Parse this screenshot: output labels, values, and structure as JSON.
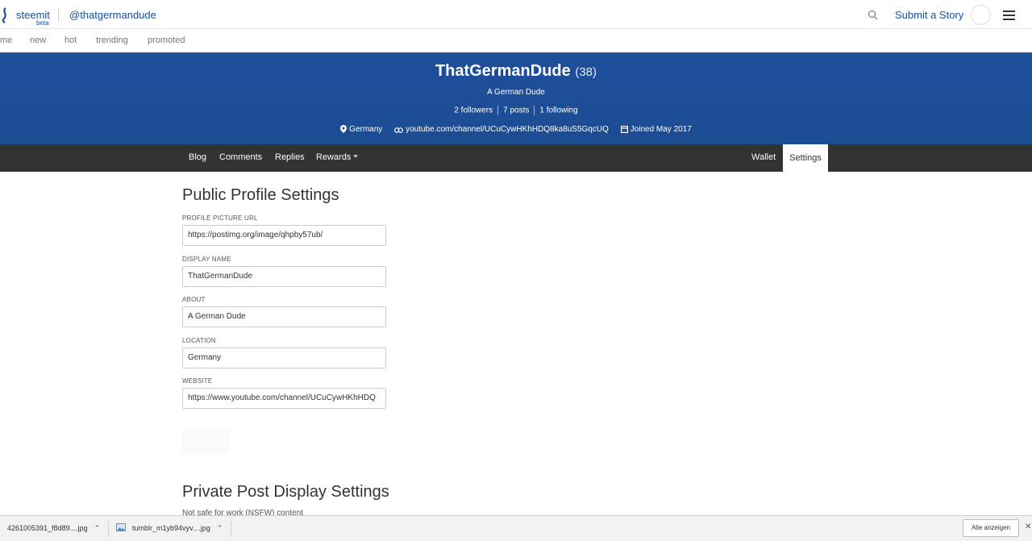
{
  "header": {
    "brand": "steemit",
    "brand_tag": "beta",
    "username": "@thatgermandude",
    "submit_label": "Submit a Story"
  },
  "subnav": {
    "items": [
      "me",
      "new",
      "hot",
      "trending",
      "promoted"
    ]
  },
  "profile": {
    "name": "ThatGermanDude",
    "reputation": "(38)",
    "about": "A German Dude",
    "followers": "2 followers",
    "posts": "7 posts",
    "following": "1 following",
    "location": "Germany",
    "website": "youtube.com/channel/UCuCywHKhHDQ8ka8uS5GqcUQ",
    "joined": "Joined May 2017"
  },
  "tabs": {
    "blog": "Blog",
    "comments": "Comments",
    "replies": "Replies",
    "rewards": "Rewards",
    "wallet": "Wallet",
    "settings": "Settings"
  },
  "settings": {
    "public_title": "Public Profile Settings",
    "fields": {
      "picture": {
        "label": "PROFILE PICTURE URL",
        "value": "https://postimg.org/image/qhpby57ub/"
      },
      "display_name": {
        "label": "DISPLAY NAME",
        "value": "ThatGermanDude"
      },
      "about": {
        "label": "ABOUT",
        "value": "A German Dude"
      },
      "location": {
        "label": "LOCATION",
        "value": "Germany"
      },
      "website": {
        "label": "WEBSITE",
        "value": "https://www.youtube.com/channel/UCuCywHKhHDQ"
      }
    },
    "private_title": "Private Post Display Settings",
    "private_subtitle": "Not safe for work (NSFW) content"
  },
  "downloads": {
    "items": [
      "4261005391_f8d89....jpg",
      "tumblr_m1yb94vyv....jpg"
    ],
    "show_all": "Alle anzeigen"
  },
  "colors": {
    "brand_blue": "#1a5099",
    "banner": "#1c4c92",
    "tab_bar": "#333333"
  }
}
